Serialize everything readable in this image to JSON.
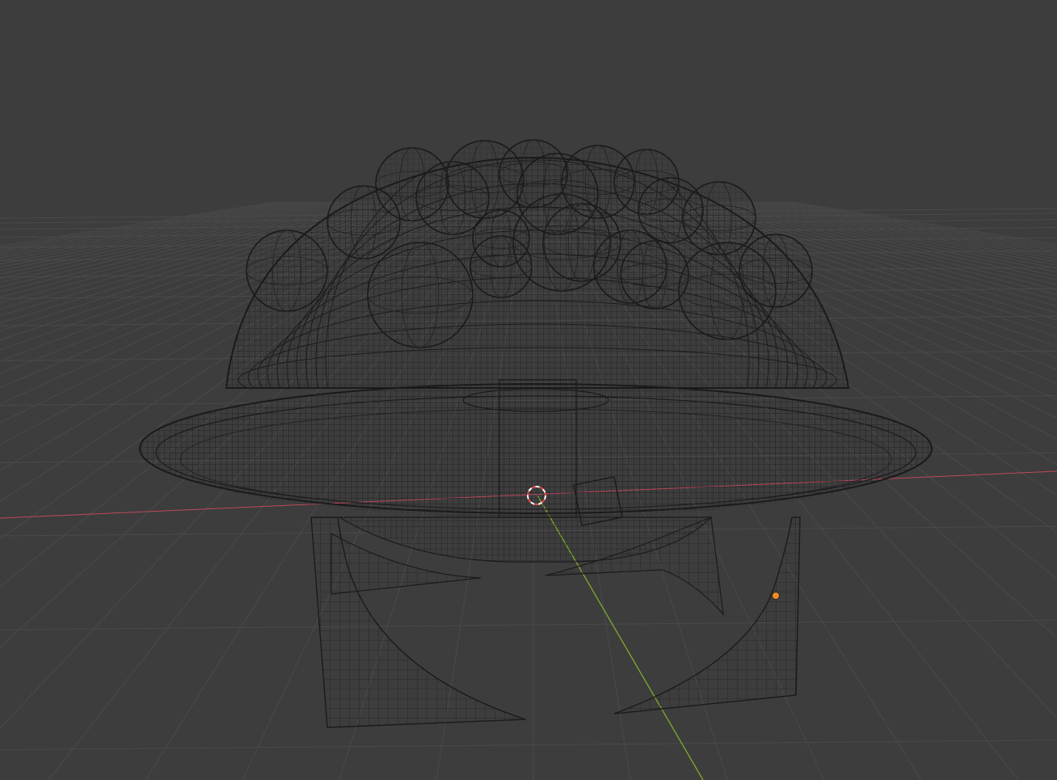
{
  "app": {
    "panel": "3D Viewport",
    "shading_mode": "wireframe"
  },
  "colors": {
    "background": "#3d3d3d",
    "grid_line": "#4a4a4a",
    "axis_x": "#c0475c",
    "axis_y": "#7faa2a",
    "wire": "#1f1f1f",
    "wire_light": "#2c2c2c",
    "origin": "#f08a24",
    "cursor_red": "#e84a4a",
    "cursor_white": "#ffffff"
  },
  "icons": {
    "cursor": "3d-cursor-icon",
    "origin": "object-origin-dot"
  }
}
